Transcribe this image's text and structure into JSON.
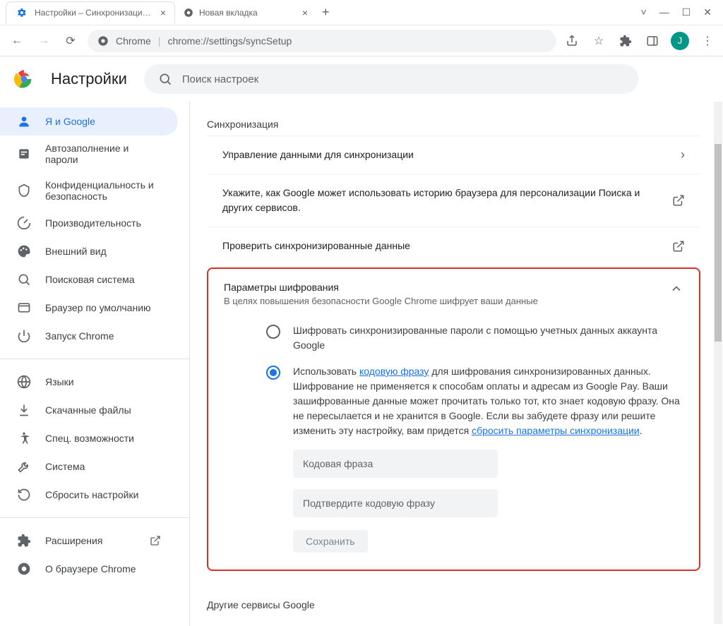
{
  "window": {
    "tabs": [
      {
        "title": "Настройки – Синхронизация се"
      },
      {
        "title": "Новая вкладка"
      }
    ]
  },
  "omnibox": {
    "scheme_label": "Chrome",
    "url": "chrome://settings/syncSetup"
  },
  "avatar_initial": "J",
  "header": {
    "title": "Настройки",
    "search_placeholder": "Поиск настроек"
  },
  "sidebar": {
    "items": [
      {
        "label": "Я и Google"
      },
      {
        "label": "Автозаполнение и пароли"
      },
      {
        "label": "Конфиденциальность и безопасность"
      },
      {
        "label": "Производительность"
      },
      {
        "label": "Внешний вид"
      },
      {
        "label": "Поисковая система"
      },
      {
        "label": "Браузер по умолчанию"
      },
      {
        "label": "Запуск Chrome"
      }
    ],
    "items2": [
      {
        "label": "Языки"
      },
      {
        "label": "Скачанные файлы"
      },
      {
        "label": "Спец. возможности"
      },
      {
        "label": "Система"
      },
      {
        "label": "Сбросить настройки"
      }
    ],
    "items3": [
      {
        "label": "Расширения"
      },
      {
        "label": "О браузере Chrome"
      }
    ]
  },
  "main": {
    "section_title": "Синхронизация",
    "rows": [
      {
        "text": "Управление данными для синхронизации"
      },
      {
        "text": "Укажите, как Google может использовать историю браузера для персонализации Поиска и других сервисов."
      },
      {
        "text": "Проверить синхронизированные данные"
      }
    ],
    "encryption": {
      "title": "Параметры шифрования",
      "sub": "В целях повышения безопасности Google Chrome шифрует ваши данные",
      "option1": "Шифровать синхронизированные пароли с помощью учетных данных аккаунта Google",
      "option2_pre": "Использовать ",
      "option2_link1": "кодовую фразу",
      "option2_mid": " для шифрования синхронизированных данных. Шифрование не применяется к способам оплаты и адресам из Google Pay. Ваши зашифрованные данные может прочитать только тот, кто знает кодовую фразу. Она не пересылается и не хранится в Google. Если вы забудете фразу или решите изменить эту настройку, вам придется ",
      "option2_link2": "сбросить параметры синхронизации",
      "option2_post": ".",
      "input1_placeholder": "Кодовая фраза",
      "input2_placeholder": "Подтвердите кодовую фразу",
      "save_label": "Сохранить"
    },
    "other_title": "Другие сервисы Google"
  }
}
